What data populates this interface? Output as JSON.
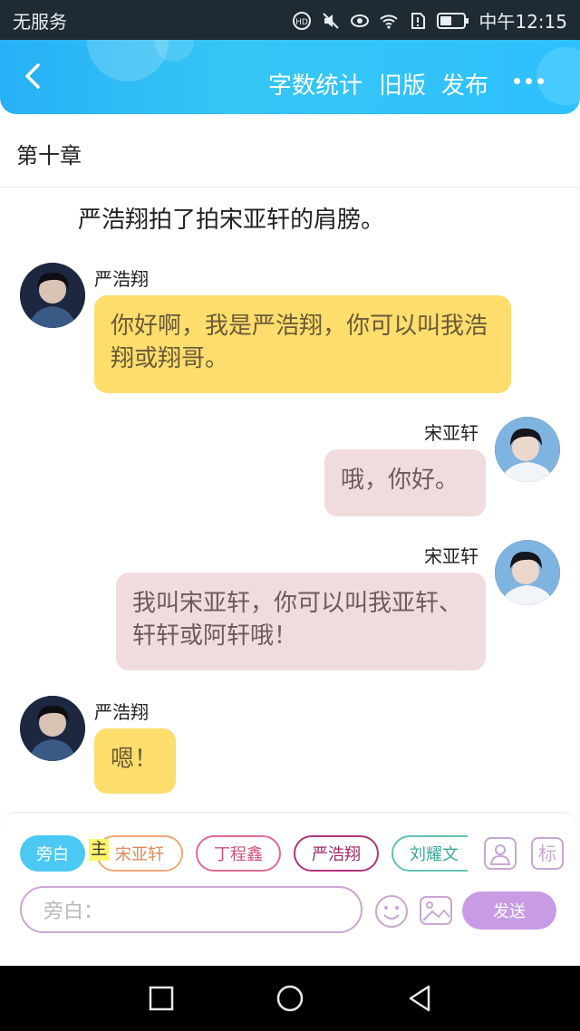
{
  "status_bar": {
    "carrier": "无服务",
    "time": "中午12:15"
  },
  "header": {
    "word_count_label": "字数统计",
    "old_version_label": "旧版",
    "publish_label": "发布"
  },
  "chapter": {
    "title": "第十章"
  },
  "narration": "严浩翔拍了拍宋亚轩的肩膀。",
  "messages": [
    {
      "sender": "严浩翔",
      "side": "left",
      "text": "你好啊，我是严浩翔，你可以叫我浩翔或翔哥。"
    },
    {
      "sender": "宋亚轩",
      "side": "right",
      "text": "哦，你好。"
    },
    {
      "sender": "宋亚轩",
      "side": "right",
      "text": "我叫宋亚轩，你可以叫我亚轩、轩轩或阿轩哦！"
    },
    {
      "sender": "严浩翔",
      "side": "left",
      "text": "嗯！"
    }
  ],
  "roles": {
    "narrator": "旁白",
    "main_tag": "主",
    "characters": [
      "宋亚轩",
      "丁程鑫",
      "严浩翔",
      "刘耀文"
    ]
  },
  "composer": {
    "placeholder": "旁白：",
    "send_label": "发送",
    "tag_icon_label": "标"
  },
  "colors": {
    "header": "#2ebcf7",
    "yellow_bubble": "#fddd6b",
    "pink_bubble": "#f1dcdd",
    "send": "#c79ce5",
    "narrator_chip": "#4cc8f4"
  }
}
